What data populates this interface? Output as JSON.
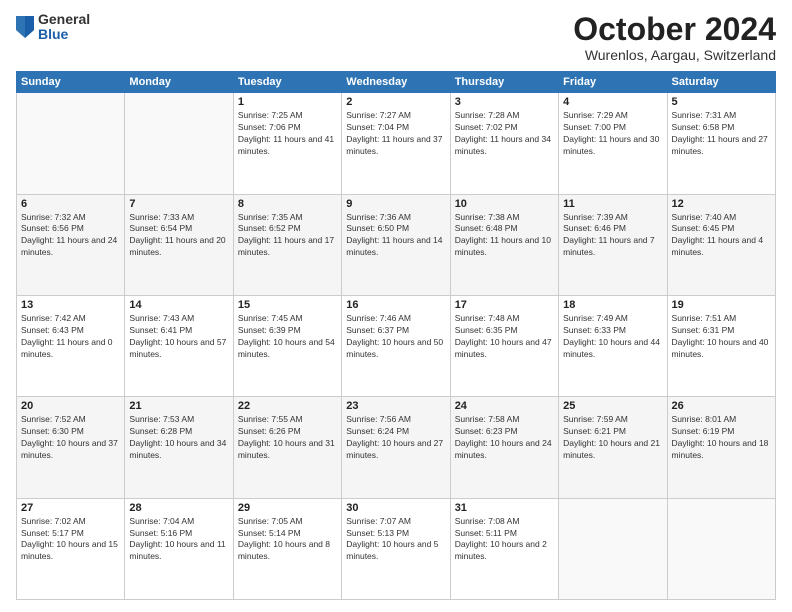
{
  "header": {
    "logo": {
      "general": "General",
      "blue": "Blue"
    },
    "title": "October 2024",
    "location": "Wurenlos, Aargau, Switzerland"
  },
  "weekdays": [
    "Sunday",
    "Monday",
    "Tuesday",
    "Wednesday",
    "Thursday",
    "Friday",
    "Saturday"
  ],
  "weeks": [
    [
      {
        "day": "",
        "info": ""
      },
      {
        "day": "",
        "info": ""
      },
      {
        "day": "1",
        "info": "Sunrise: 7:25 AM\nSunset: 7:06 PM\nDaylight: 11 hours and 41 minutes."
      },
      {
        "day": "2",
        "info": "Sunrise: 7:27 AM\nSunset: 7:04 PM\nDaylight: 11 hours and 37 minutes."
      },
      {
        "day": "3",
        "info": "Sunrise: 7:28 AM\nSunset: 7:02 PM\nDaylight: 11 hours and 34 minutes."
      },
      {
        "day": "4",
        "info": "Sunrise: 7:29 AM\nSunset: 7:00 PM\nDaylight: 11 hours and 30 minutes."
      },
      {
        "day": "5",
        "info": "Sunrise: 7:31 AM\nSunset: 6:58 PM\nDaylight: 11 hours and 27 minutes."
      }
    ],
    [
      {
        "day": "6",
        "info": "Sunrise: 7:32 AM\nSunset: 6:56 PM\nDaylight: 11 hours and 24 minutes."
      },
      {
        "day": "7",
        "info": "Sunrise: 7:33 AM\nSunset: 6:54 PM\nDaylight: 11 hours and 20 minutes."
      },
      {
        "day": "8",
        "info": "Sunrise: 7:35 AM\nSunset: 6:52 PM\nDaylight: 11 hours and 17 minutes."
      },
      {
        "day": "9",
        "info": "Sunrise: 7:36 AM\nSunset: 6:50 PM\nDaylight: 11 hours and 14 minutes."
      },
      {
        "day": "10",
        "info": "Sunrise: 7:38 AM\nSunset: 6:48 PM\nDaylight: 11 hours and 10 minutes."
      },
      {
        "day": "11",
        "info": "Sunrise: 7:39 AM\nSunset: 6:46 PM\nDaylight: 11 hours and 7 minutes."
      },
      {
        "day": "12",
        "info": "Sunrise: 7:40 AM\nSunset: 6:45 PM\nDaylight: 11 hours and 4 minutes."
      }
    ],
    [
      {
        "day": "13",
        "info": "Sunrise: 7:42 AM\nSunset: 6:43 PM\nDaylight: 11 hours and 0 minutes."
      },
      {
        "day": "14",
        "info": "Sunrise: 7:43 AM\nSunset: 6:41 PM\nDaylight: 10 hours and 57 minutes."
      },
      {
        "day": "15",
        "info": "Sunrise: 7:45 AM\nSunset: 6:39 PM\nDaylight: 10 hours and 54 minutes."
      },
      {
        "day": "16",
        "info": "Sunrise: 7:46 AM\nSunset: 6:37 PM\nDaylight: 10 hours and 50 minutes."
      },
      {
        "day": "17",
        "info": "Sunrise: 7:48 AM\nSunset: 6:35 PM\nDaylight: 10 hours and 47 minutes."
      },
      {
        "day": "18",
        "info": "Sunrise: 7:49 AM\nSunset: 6:33 PM\nDaylight: 10 hours and 44 minutes."
      },
      {
        "day": "19",
        "info": "Sunrise: 7:51 AM\nSunset: 6:31 PM\nDaylight: 10 hours and 40 minutes."
      }
    ],
    [
      {
        "day": "20",
        "info": "Sunrise: 7:52 AM\nSunset: 6:30 PM\nDaylight: 10 hours and 37 minutes."
      },
      {
        "day": "21",
        "info": "Sunrise: 7:53 AM\nSunset: 6:28 PM\nDaylight: 10 hours and 34 minutes."
      },
      {
        "day": "22",
        "info": "Sunrise: 7:55 AM\nSunset: 6:26 PM\nDaylight: 10 hours and 31 minutes."
      },
      {
        "day": "23",
        "info": "Sunrise: 7:56 AM\nSunset: 6:24 PM\nDaylight: 10 hours and 27 minutes."
      },
      {
        "day": "24",
        "info": "Sunrise: 7:58 AM\nSunset: 6:23 PM\nDaylight: 10 hours and 24 minutes."
      },
      {
        "day": "25",
        "info": "Sunrise: 7:59 AM\nSunset: 6:21 PM\nDaylight: 10 hours and 21 minutes."
      },
      {
        "day": "26",
        "info": "Sunrise: 8:01 AM\nSunset: 6:19 PM\nDaylight: 10 hours and 18 minutes."
      }
    ],
    [
      {
        "day": "27",
        "info": "Sunrise: 7:02 AM\nSunset: 5:17 PM\nDaylight: 10 hours and 15 minutes."
      },
      {
        "day": "28",
        "info": "Sunrise: 7:04 AM\nSunset: 5:16 PM\nDaylight: 10 hours and 11 minutes."
      },
      {
        "day": "29",
        "info": "Sunrise: 7:05 AM\nSunset: 5:14 PM\nDaylight: 10 hours and 8 minutes."
      },
      {
        "day": "30",
        "info": "Sunrise: 7:07 AM\nSunset: 5:13 PM\nDaylight: 10 hours and 5 minutes."
      },
      {
        "day": "31",
        "info": "Sunrise: 7:08 AM\nSunset: 5:11 PM\nDaylight: 10 hours and 2 minutes."
      },
      {
        "day": "",
        "info": ""
      },
      {
        "day": "",
        "info": ""
      }
    ]
  ]
}
